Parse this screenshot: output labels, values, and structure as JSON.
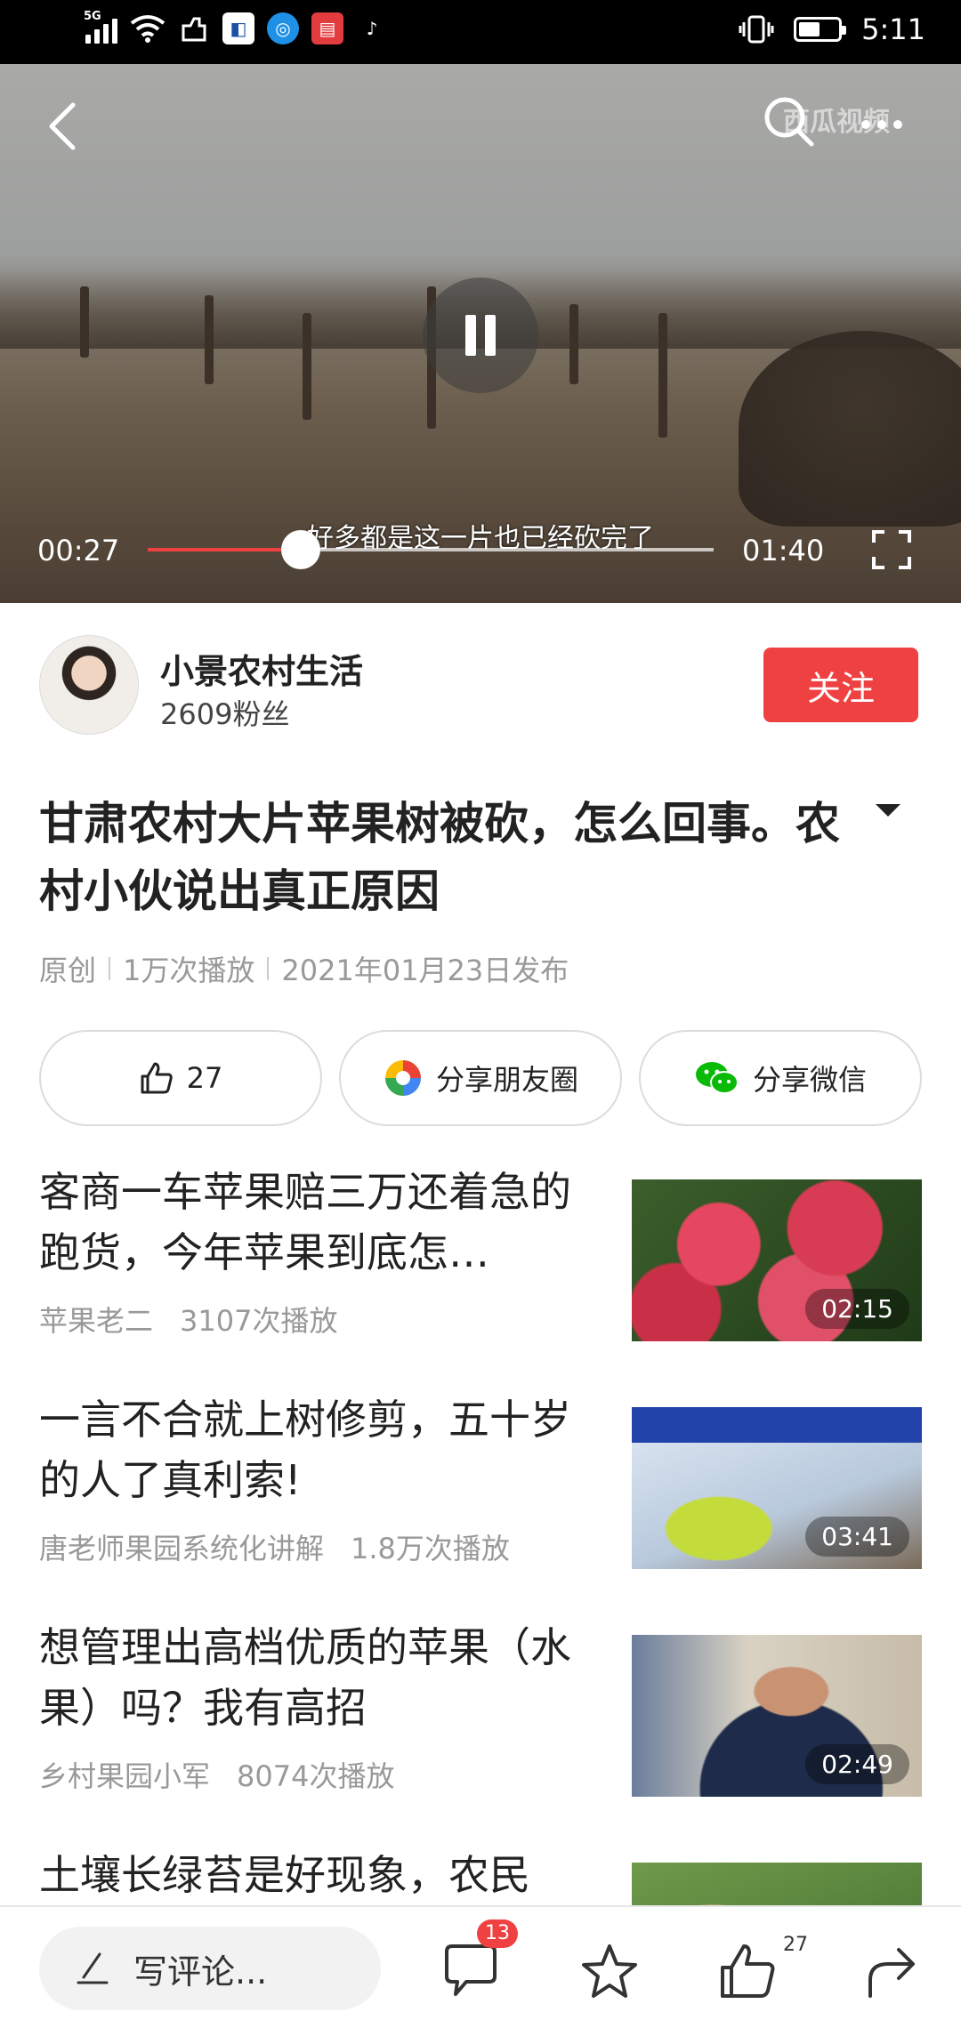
{
  "status_bar": {
    "network": "5G",
    "time": "5:11",
    "battery_level": 0.6,
    "app_icons": [
      "cloud-icon",
      "app-icon-blue",
      "app-icon-browser",
      "app-icon-red-book",
      "tiktok-icon"
    ]
  },
  "video": {
    "watermark": "西瓜视频",
    "subtitle": "好多都是这一片也已经砍完了",
    "current_time": "00:27",
    "duration": "01:40",
    "progress": 0.27,
    "state": "playing"
  },
  "author": {
    "name": "小景农村生活",
    "fans": "2609粉丝",
    "follow_label": "关注"
  },
  "content": {
    "title": "甘肃农村大片苹果树被砍，怎么回事。农村小伙说出真正原因",
    "meta": [
      "原创",
      "1万次播放",
      "2021年01月23日发布"
    ]
  },
  "actions": {
    "like_count": "27",
    "share_moments": "分享朋友圈",
    "share_wechat": "分享微信"
  },
  "related": [
    {
      "title": "客商一车苹果赔三万还着急的跑货，今年苹果到底怎…",
      "author": "苹果老二",
      "plays": "3107次播放",
      "duration": "02:15"
    },
    {
      "title": "一言不合就上树修剪，五十岁的人了真利索!",
      "author": "唐老师果园系统化讲解",
      "plays": "1.8万次播放",
      "duration": "03:41"
    },
    {
      "title": "想管理出高档优质的苹果（水果）吗？我有高招",
      "author": "乡村果园小军",
      "plays": "8074次播放",
      "duration": "02:49"
    },
    {
      "title": "土壤长绿苔是好现象，农民",
      "author": "",
      "plays": "",
      "duration": ""
    }
  ],
  "bottom_bar": {
    "comment_placeholder": "写评论...",
    "comment_count": "13",
    "like_count": "27"
  },
  "colors": {
    "accent": "#f04142",
    "text": "#222222",
    "muted": "#999999"
  }
}
